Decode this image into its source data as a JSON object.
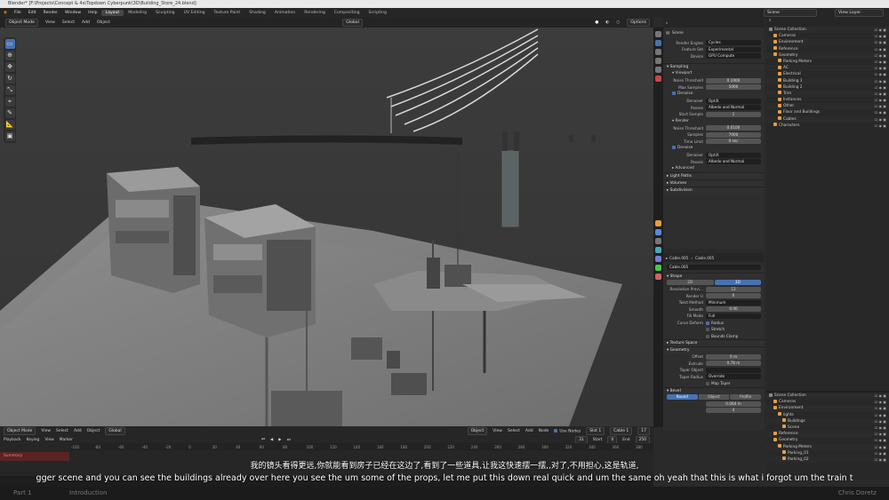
{
  "title_bar": {
    "text": "Blender* [F:\\Projects\\Concept & 4x\\Topdown Cyberpunk\\3D\\Building_Store_24.blend]"
  },
  "menu": [
    "File",
    "Edit",
    "Render",
    "Window",
    "Help"
  ],
  "workspaces": [
    "Layout",
    "Modeling",
    "Sculpting",
    "UV Editing",
    "Texture Paint",
    "Shading",
    "Animation",
    "Rendering",
    "Compositing",
    "Scripting"
  ],
  "active_workspace": "Layout",
  "scene_field": "Scene",
  "view_layer_field": "View Layer",
  "viewport_header": {
    "mode": "Object Mode",
    "view": "View",
    "select": "Select",
    "add": "Add",
    "object": "Object",
    "orientation": "Global",
    "options": "Options"
  },
  "properties": {
    "scene": "Scene",
    "render_engine_label": "Render Engine",
    "render_engine": "Cycles",
    "feature_set_label": "Feature Set",
    "feature_set": "Experimental",
    "device_label": "Device",
    "device": "GPU Compute",
    "sampling": "Sampling",
    "viewport": "Viewport",
    "noise_threshold_label": "Noise Threshold",
    "noise_threshold_v": "0.1000",
    "max_samples_label": "Max Samples",
    "max_samples_v": "5000",
    "denoise": "Denoise",
    "denoiser_label": "Denoiser",
    "denoiser_v": "OptiX",
    "passes_label": "Passes",
    "passes_v": "Albedo and Normal",
    "start_sample_label": "Start Sample",
    "start_sample_v": "1",
    "render": "Render",
    "r_noise_threshold_v": "0.0100",
    "samples_label": "Samples",
    "r_samples_v": "7000",
    "time_limit_label": "Time Limit",
    "time_limit_v": "0 sec",
    "r_denoiser_v": "OptiX",
    "r_passes_v": "Albedo and Normal",
    "advanced": "Advanced",
    "light_paths": "Light Paths",
    "volumes": "Volumes",
    "subdivision": "Subdivision"
  },
  "curve_props": {
    "object_name": "Cable.005",
    "data_name": "Cable.005",
    "field": "Cable.005",
    "shape": "Shape",
    "btn_2d": "2D",
    "btn_3d": "3D",
    "res_preview_label": "Resolution Previ...",
    "res_preview_v": "12",
    "render_u_label": "Render U",
    "render_u_v": "0",
    "twist_method_label": "Twist Method",
    "twist_method_v": "Minimum",
    "smooth_label": "Smooth",
    "smooth_v": "0.00",
    "fill_mode_label": "Fill Mode",
    "fill_mode_v": "Full",
    "curve_deform_label": "Curve Deform",
    "radius": "Radius",
    "stretch": "Stretch",
    "bounds_clamp": "Bounds Clamp",
    "texture_space": "Texture Space",
    "geometry": "Geometry",
    "offset_label": "Offset",
    "offset_v": "0 m",
    "extrude_label": "Extrude",
    "extrude_v": "0.78 m",
    "taper_object_label": "Taper Object",
    "taper_radius_label": "Taper Radius",
    "taper_radius_v": "Override",
    "map_taper": "Map Taper",
    "bevel": "Bevel",
    "round": "Round",
    "object": "Object",
    "profile": "Profile",
    "depth_v": "0.064 m",
    "resolution_v": "4"
  },
  "outliner": {
    "header": "Scene Collection",
    "items": [
      {
        "name": "Scene Collection",
        "indent": 0
      },
      {
        "name": "Cameras",
        "indent": 1
      },
      {
        "name": "Environment",
        "indent": 1
      },
      {
        "name": "Reference",
        "indent": 1
      },
      {
        "name": "Geometry",
        "indent": 1
      },
      {
        "name": "Parking Meters",
        "indent": 2
      },
      {
        "name": "AC",
        "indent": 2
      },
      {
        "name": "Electrical",
        "indent": 2
      },
      {
        "name": "Building 1",
        "indent": 2
      },
      {
        "name": "Building 2",
        "indent": 2
      },
      {
        "name": "Trim",
        "indent": 2
      },
      {
        "name": "Instances",
        "indent": 2
      },
      {
        "name": "Other",
        "indent": 2
      },
      {
        "name": "Floor and Buildings",
        "indent": 2
      },
      {
        "name": "Cables",
        "indent": 2
      },
      {
        "name": "Characters",
        "indent": 1
      }
    ]
  },
  "outliner2": {
    "items": [
      {
        "name": "Scene Collection",
        "indent": 0
      },
      {
        "name": "Cameras",
        "indent": 1
      },
      {
        "name": "Environment",
        "indent": 1
      },
      {
        "name": "lights",
        "indent": 2
      },
      {
        "name": "Buildings",
        "indent": 3
      },
      {
        "name": "Scene",
        "indent": 3
      },
      {
        "name": "Reference",
        "indent": 1
      },
      {
        "name": "Geometry",
        "indent": 1
      },
      {
        "name": "Parking Meters",
        "indent": 2
      },
      {
        "name": "Parking_01",
        "indent": 3
      },
      {
        "name": "Parking_02",
        "indent": 3
      }
    ]
  },
  "node_header": {
    "mode": "Object Mode",
    "view": "View",
    "select": "Select",
    "add": "Add",
    "object": "Object",
    "global": "Global",
    "object2": "Object",
    "view2": "View",
    "select2": "Select",
    "add2": "Add",
    "node": "Node",
    "use_nodes": "Use Nodes",
    "slot": "Slot 1",
    "cable": "Cable 1",
    "users": "17"
  },
  "timeline": {
    "playback": "Playback",
    "keying": "Keying",
    "view": "View",
    "marker": "Marker",
    "frame": "31",
    "start_label": "Start",
    "start_v": "0",
    "end_label": "End",
    "end_v": "250",
    "summary": "Summary",
    "ticks": [
      "-100",
      "-80",
      "-60",
      "-40",
      "-20",
      "0",
      "20",
      "40",
      "60",
      "80",
      "100",
      "120",
      "140",
      "160",
      "180",
      "200",
      "220",
      "240",
      "260",
      "280",
      "300",
      "320",
      "340",
      "360",
      "380"
    ]
  },
  "subtitle_cn": "我的镜头看得更远,你就能看到房子已经在这边了,看到了一些道具,让我这快速摆一摆,,对了,不用担心,这是轨道,",
  "subtitle_en": "gger scene and you can see the buildings already over here you see the um some of the props, let me put this down real quick and um the same oh yeah that this is what i forgot um the train t",
  "footer": {
    "part": "Part 1",
    "chapter": "Introduction",
    "author": "Chris Doretz"
  }
}
